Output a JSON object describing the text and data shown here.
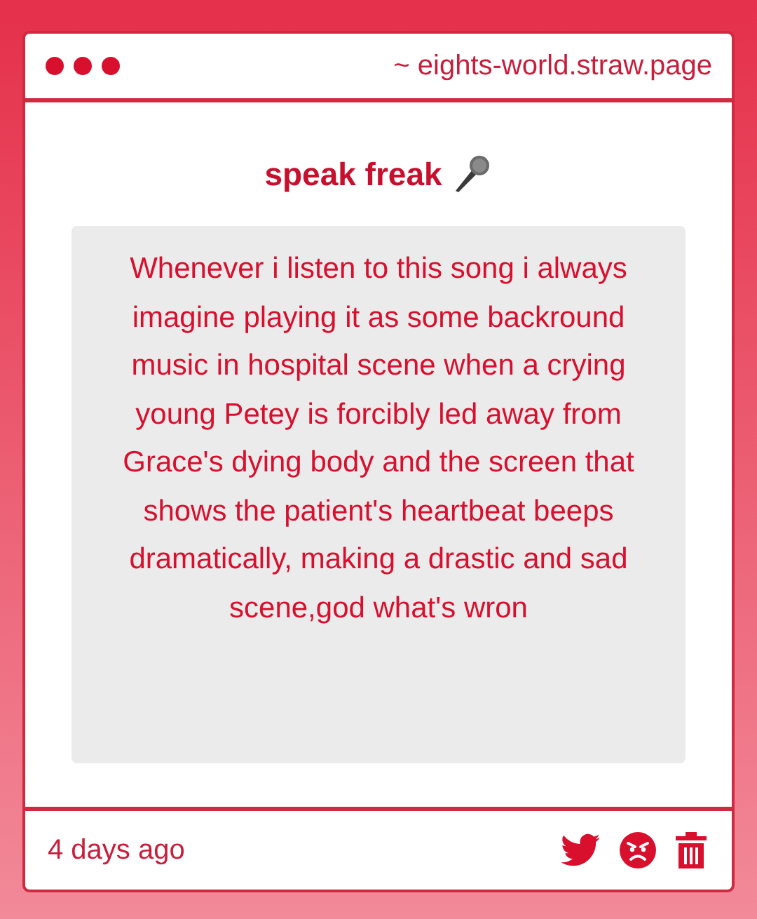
{
  "window": {
    "address": "~ eights-world.straw.page"
  },
  "post": {
    "title": "speak freak",
    "message": "Whenever i listen to this song i always imagine playing it as some backround music in hospital scene when a crying young Petey is forcibly led away from Grace's dying body and the screen that shows the patient's heartbeat beeps dramatically, making a drastic and sad scene,god what's wron"
  },
  "footer": {
    "time": "4 days ago"
  }
}
